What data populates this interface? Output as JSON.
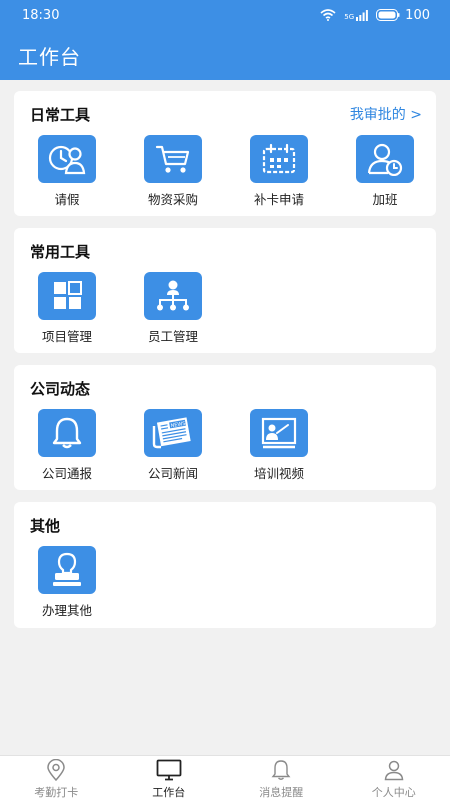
{
  "status_bar": {
    "time": "18:30",
    "network": "5G",
    "battery": "100"
  },
  "header": {
    "title": "工作台"
  },
  "sections": {
    "daily": {
      "title": "日常工具",
      "link": "我审批的 >",
      "items": [
        {
          "label": "请假",
          "icon": "leave-icon"
        },
        {
          "label": "物资采购",
          "icon": "shopping-cart-icon"
        },
        {
          "label": "补卡申请",
          "icon": "calendar-icon"
        },
        {
          "label": "加班",
          "icon": "overtime-icon"
        }
      ]
    },
    "common": {
      "title": "常用工具",
      "items": [
        {
          "label": "项目管理",
          "icon": "grid-icon"
        },
        {
          "label": "员工管理",
          "icon": "org-chart-icon"
        }
      ]
    },
    "company": {
      "title": "公司动态",
      "items": [
        {
          "label": "公司通报",
          "icon": "bell-icon"
        },
        {
          "label": "公司新闻",
          "icon": "newspaper-icon"
        },
        {
          "label": "培训视频",
          "icon": "presentation-icon"
        }
      ]
    },
    "other": {
      "title": "其他",
      "items": [
        {
          "label": "办理其他",
          "icon": "stamp-icon"
        }
      ]
    }
  },
  "bottom_nav": {
    "items": [
      {
        "label": "考勤打卡",
        "icon": "location-pin-icon",
        "active": false
      },
      {
        "label": "工作台",
        "icon": "monitor-icon",
        "active": true
      },
      {
        "label": "消息提醒",
        "icon": "bell-outline-icon",
        "active": false
      },
      {
        "label": "个人中心",
        "icon": "user-icon",
        "active": false
      }
    ]
  },
  "colors": {
    "primary": "#3d8fe5",
    "link": "#2f86e0",
    "background": "#f1f1f1"
  }
}
